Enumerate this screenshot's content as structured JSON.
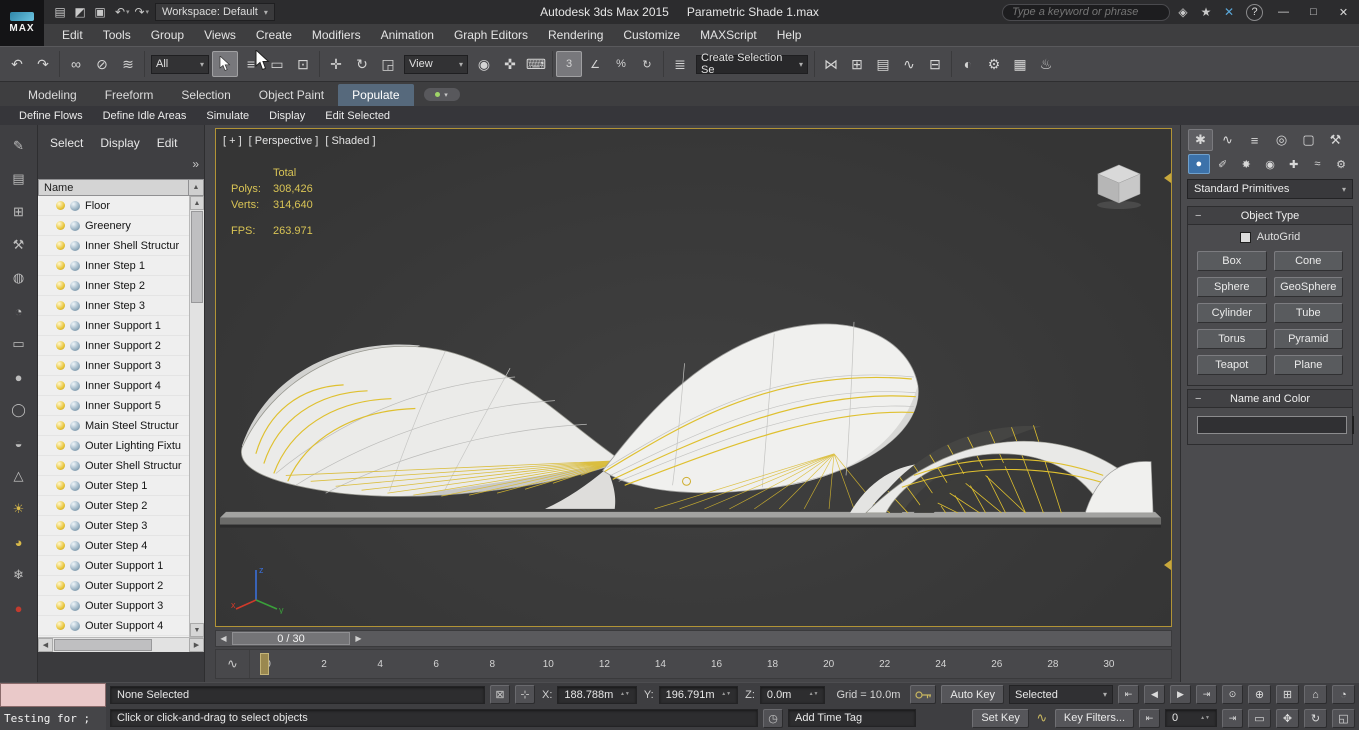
{
  "titlebar": {
    "logo_text": "MAX",
    "app_name": "Autodesk 3ds Max 2015",
    "doc_name": "Parametric Shade 1.max",
    "workspace": "Workspace: Default",
    "search_placeholder": "Type a keyword or phrase"
  },
  "menubar": {
    "items": [
      "Edit",
      "Tools",
      "Group",
      "Views",
      "Create",
      "Modifiers",
      "Animation",
      "Graph Editors",
      "Rendering",
      "Customize",
      "MAXScript",
      "Help"
    ]
  },
  "toolbar": {
    "filter": "All",
    "coord_system": "View",
    "selection_set": "Create Selection Se"
  },
  "ribbon": {
    "tabs": [
      "Modeling",
      "Freeform",
      "Selection",
      "Object Paint",
      "Populate"
    ],
    "active_tab": "Populate",
    "sub_items": [
      "Define Flows",
      "Define Idle Areas",
      "Simulate",
      "Display",
      "Edit Selected"
    ]
  },
  "explorer": {
    "menu": [
      "Select",
      "Display",
      "Edit"
    ],
    "header": "Name",
    "items": [
      "Floor",
      "Greenery",
      "Inner Shell Structur",
      "Inner Step 1",
      "Inner Step 2",
      "Inner Step 3",
      "Inner Support 1",
      "Inner Support 2",
      "Inner Support 3",
      "Inner Support 4",
      "Inner Support 5",
      "Main Steel Structur",
      "Outer Lighting Fixtu",
      "Outer Shell Structur",
      "Outer Step 1",
      "Outer Step 2",
      "Outer Step 3",
      "Outer Step 4",
      "Outer Support 1",
      "Outer Support 2",
      "Outer Support 3",
      "Outer Support 4"
    ]
  },
  "viewport": {
    "label_menu": "[ + ]",
    "label_pov": "[ Perspective ]",
    "label_shading": "[ Shaded ]",
    "stats": {
      "total_label": "Total",
      "polys_label": "Polys:",
      "polys_value": "308,426",
      "verts_label": "Verts:",
      "verts_value": "314,640",
      "fps_label": "FPS:",
      "fps_value": "263.971"
    }
  },
  "command_panel": {
    "category": "Standard Primitives",
    "object_type": {
      "title": "Object Type",
      "autogrid": "AutoGrid",
      "buttons": [
        "Box",
        "Cone",
        "Sphere",
        "GeoSphere",
        "Cylinder",
        "Tube",
        "Torus",
        "Pyramid",
        "Teapot",
        "Plane"
      ]
    },
    "name_color": {
      "title": "Name and Color",
      "name_value": "",
      "swatch_color": "#d82b93",
      "swatch_style": "background:#d82b93"
    }
  },
  "timeline": {
    "slider": "0 / 30",
    "ticks": [
      "0",
      "2",
      "4",
      "6",
      "8",
      "10",
      "12",
      "14",
      "16",
      "18",
      "20",
      "22",
      "24",
      "26",
      "28",
      "30"
    ]
  },
  "status": {
    "listener_text": "Testing for ;",
    "selection": "None Selected",
    "prompt": "Click or click-and-drag to select objects",
    "x_label": "X:",
    "x_value": "188.788m",
    "y_label": "Y:",
    "y_value": "196.791m",
    "z_label": "Z:",
    "z_value": "0.0m",
    "grid": "Grid = 10.0m",
    "add_time_tag": "Add Time Tag",
    "auto_key": "Auto Key",
    "set_key": "Set Key",
    "key_mode": "Selected",
    "key_filters": "Key Filters...",
    "frame": "0"
  },
  "colors": {
    "viewport_border": "#b29436",
    "stats_yellow": "#d9c455",
    "structure_yellow": "#dfc02f",
    "populate_tab": "#56697c"
  },
  "icons": {
    "new_file": "▤",
    "open_file": "◩",
    "save_file": "▣",
    "undo": "↶",
    "redo": "↷",
    "dropdown": "▾",
    "search_next": "◈",
    "favorites": "★",
    "sign_in": "✕",
    "help": "?",
    "minimize": "—",
    "maximize": "□",
    "close": "✕",
    "select_link": "∞",
    "unlink": "⊘",
    "bind_spacewarp": "≋",
    "select_by_name": "≡",
    "rect_region": "▭",
    "window_crossing": "⊡",
    "move": "✛",
    "rotate": "↻",
    "scale": "◲",
    "pivot_center": "◉",
    "manipulate": "✜",
    "keyboard_override": "⌨",
    "snap_3d": "3",
    "snap_angle": "∠",
    "snap_percent": "%",
    "snap_spinner": "↻",
    "named_sets": "≣",
    "mirror": "⋈",
    "align": "⊞",
    "layer_manager": "▤",
    "curve_editor": "∿",
    "schematic_view": "⊟",
    "material_editor": "◐",
    "render_setup": "⚙",
    "rendered_frame": "▦",
    "render_production": "♨",
    "overflow": "»",
    "scroll_up": "▲",
    "scroll_down": "▼",
    "scroll_left": "◀",
    "scroll_right": "▶",
    "slider_left": "◀",
    "slider_right": "▶",
    "mini_curve": "∿",
    "lock": "⊠",
    "absolute_mode": "⊹",
    "time_tag": "◷",
    "go_start": "⇤",
    "prev_frame": "◀",
    "play": "▶",
    "go_end": "⇥",
    "key_step": "⊙",
    "zoom": "⊕",
    "zoom_all": "⊞",
    "zoom_extents": "⌂",
    "zoom_region": "▭",
    "pan": "✥",
    "orbit": "↻",
    "maximize_viewport": "◱",
    "fov": "◔",
    "cp_create": "✱",
    "cp_modify": "∿",
    "cp_hierarchy": "≡",
    "cp_motion": "◎",
    "cp_display": "▢",
    "cp_utilities": "⚒",
    "sub_geometry": "●",
    "sub_shapes": "✐",
    "sub_lights": "✸",
    "sub_cameras": "◉",
    "sub_helpers": "✚",
    "sub_spacewarps": "≈",
    "sub_systems": "⚙",
    "left_strip": [
      "✎",
      "▤",
      "⊞",
      "⚒",
      "◍",
      "◔",
      "▭",
      "●",
      "◯",
      "◒",
      "△",
      "☀",
      "◕",
      "❄",
      "●"
    ]
  }
}
